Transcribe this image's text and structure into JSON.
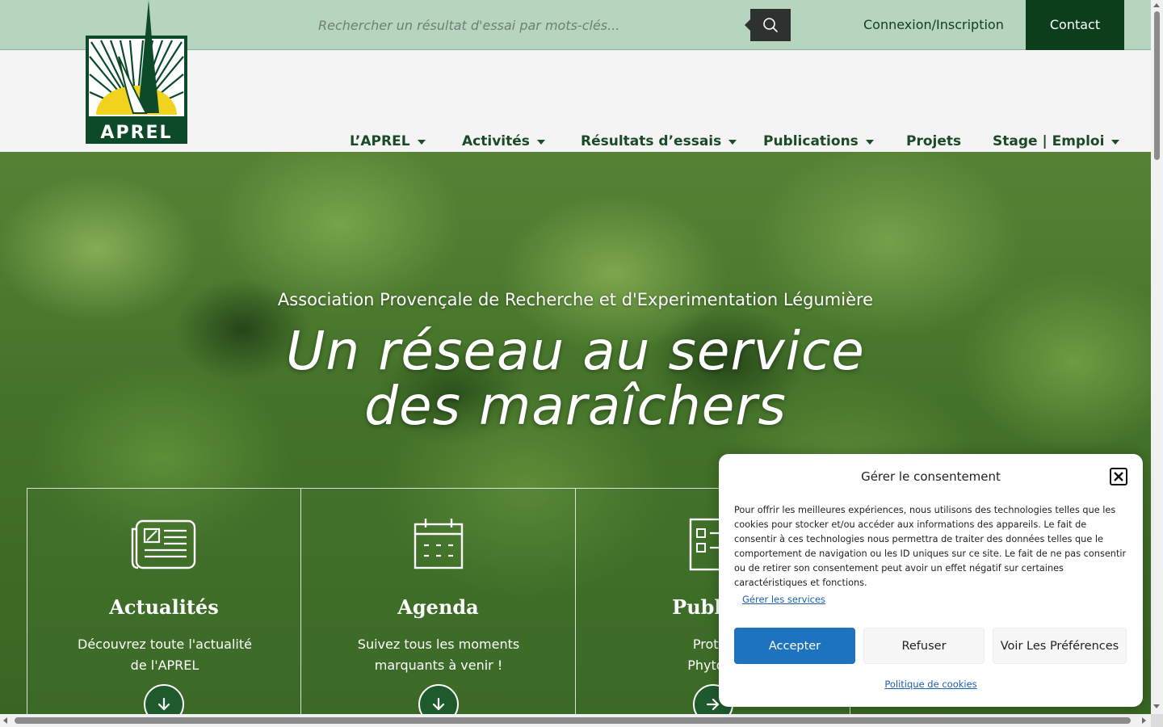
{
  "search": {
    "placeholder": "Rechercher un résultat d'essai par mots-clés..."
  },
  "topbar": {
    "login_label": "Connexion/Inscription",
    "contact_label": "Contact"
  },
  "logo": {
    "text": "APREL"
  },
  "nav": {
    "items": [
      {
        "label": "L’APREL",
        "has_dropdown": true
      },
      {
        "label": "Activités",
        "has_dropdown": true
      },
      {
        "label": "Résultats d’essais",
        "has_dropdown": true
      },
      {
        "label": "Publications",
        "has_dropdown": true
      },
      {
        "label": "Projets",
        "has_dropdown": false
      },
      {
        "label": "Stage | Emploi",
        "has_dropdown": true
      }
    ]
  },
  "hero": {
    "subtitle": "Association Provençale de Recherche et d'Experimentation Légumière",
    "title_line1": "Un réseau au service",
    "title_line2": "des maraîchers"
  },
  "cards": [
    {
      "title": "Actualités",
      "desc_line1": "Découvrez toute l'actualité",
      "desc_line2": "de l'APREL",
      "icon": "newspaper-icon",
      "arrow": "arrow-down-icon"
    },
    {
      "title": "Agenda",
      "desc_line1": "Suivez tous les moments",
      "desc_line2": "marquants à venir !",
      "icon": "calendar-icon",
      "arrow": "arrow-down-icon"
    },
    {
      "title": "Publica",
      "desc_line1": "Protec",
      "desc_line2": "Phytosa",
      "icon": "checklist-icon",
      "arrow": "arrow-right-icon"
    }
  ],
  "cookie": {
    "title": "Gérer le consentement",
    "text": "Pour offrir les meilleures expériences, nous utilisons des technologies telles que les cookies pour stocker et/ou accéder aux informations des appareils. Le fait de consentir à ces technologies nous permettra de traiter des données telles que le comportement de navigation ou les ID uniques sur ce site. Le fait de ne pas consentir ou de retirer son consentement peut avoir un effet négatif sur certaines caractéristiques et fonctions.",
    "manage_label": "Gérer les services",
    "accept_label": "Accepter",
    "refuse_label": "Refuser",
    "prefs_label": "Voir Les Préférences",
    "policy_label": "Politique de cookies"
  },
  "colors": {
    "topbar_bg": "#b5d5bf",
    "brand_dark_green": "#0d3e1b",
    "nav_text": "#1a4a26",
    "accept_blue": "#1e73be",
    "logo_yellow": "#f1d21c"
  }
}
